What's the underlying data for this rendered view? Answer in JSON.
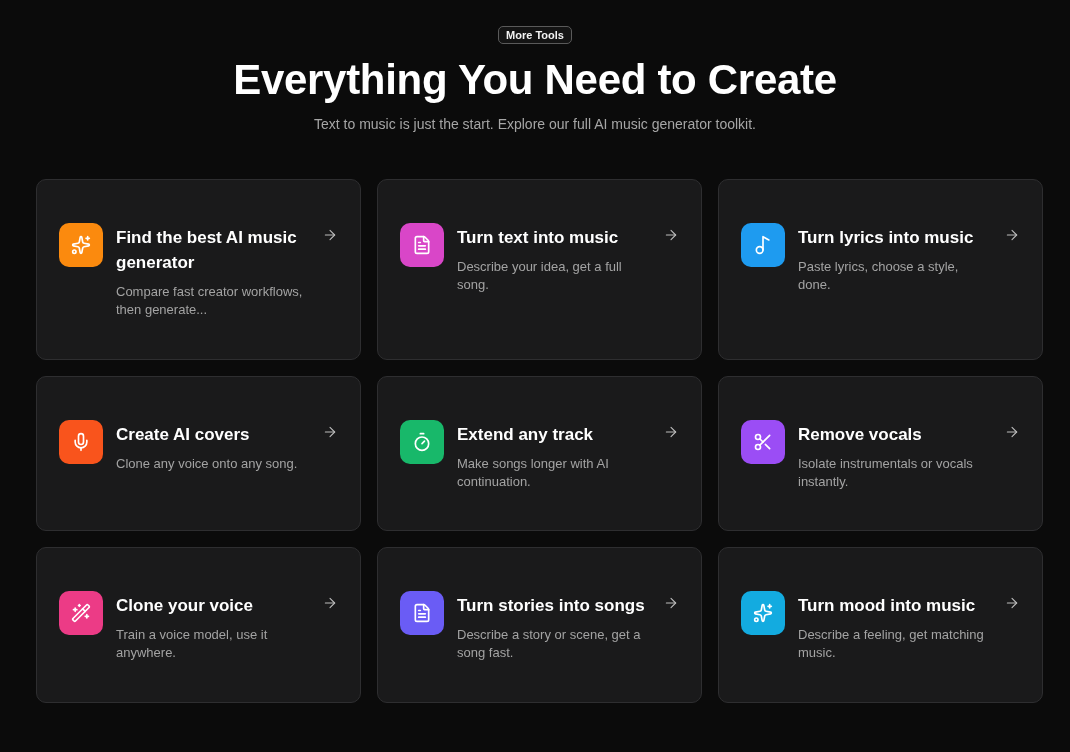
{
  "badge": "More Tools",
  "heading": "Everything You Need to Create",
  "subtitle": "Text to music is just the start. Explore our full AI music generator toolkit.",
  "cards": [
    {
      "kind": "sparkles",
      "color": "#fb8a0e",
      "title": "Find the best AI music generator",
      "description": "Compare fast creator workflows, then generate..."
    },
    {
      "kind": "document",
      "color": "#d946c8",
      "title": "Turn text into music",
      "description": "Describe your idea, get a full song."
    },
    {
      "kind": "music",
      "color": "#1e9bf0",
      "title": "Turn lyrics into music",
      "description": "Paste lyrics, choose a style, done."
    },
    {
      "kind": "microphone",
      "color": "#f9541c",
      "title": "Create AI covers",
      "description": "Clone any voice onto any song."
    },
    {
      "kind": "timer",
      "color": "#18b86a",
      "title": "Extend any track",
      "description": "Make songs longer with AI continuation."
    },
    {
      "kind": "scissors",
      "color": "#9b4df5",
      "title": "Remove vocals",
      "description": "Isolate instrumentals or vocals instantly."
    },
    {
      "kind": "wand",
      "color": "#ec3b86",
      "title": "Clone your voice",
      "description": "Train a voice model, use it anywhere."
    },
    {
      "kind": "document",
      "color": "#6a5cf5",
      "title": "Turn stories into songs",
      "description": "Describe a story or scene, get a song fast."
    },
    {
      "kind": "sparkles",
      "color": "#13abe0",
      "title": "Turn mood into music",
      "description": "Describe a feeling, get matching music."
    }
  ]
}
